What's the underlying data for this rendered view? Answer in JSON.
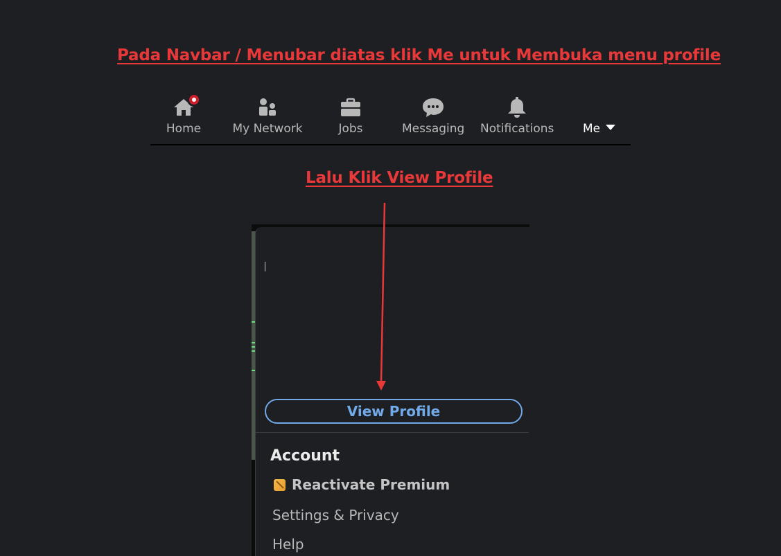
{
  "annotations": {
    "step1": "Pada Navbar / Menubar diatas klik Me untuk Membuka menu profile",
    "step2": "Lalu Klik View Profile"
  },
  "navbar": {
    "items": [
      {
        "label": "Home",
        "icon": "home-icon",
        "has_notification": true
      },
      {
        "label": "My Network",
        "icon": "network-icon"
      },
      {
        "label": "Jobs",
        "icon": "briefcase-icon"
      },
      {
        "label": "Messaging",
        "icon": "messaging-icon"
      },
      {
        "label": "Notifications",
        "icon": "bell-icon"
      },
      {
        "label": "Me",
        "icon": "caret-down-icon"
      }
    ]
  },
  "dropdown": {
    "view_profile_label": "View Profile",
    "account_heading": "Account",
    "items": [
      {
        "label": "Reactivate Premium",
        "icon": "premium-icon"
      },
      {
        "label": "Settings & Privacy"
      },
      {
        "label": "Help"
      }
    ]
  },
  "colors": {
    "background": "#1d1f23",
    "annotation": "#e8383a",
    "link_blue": "#72a9e8",
    "badge_red": "#cc1f2d"
  }
}
